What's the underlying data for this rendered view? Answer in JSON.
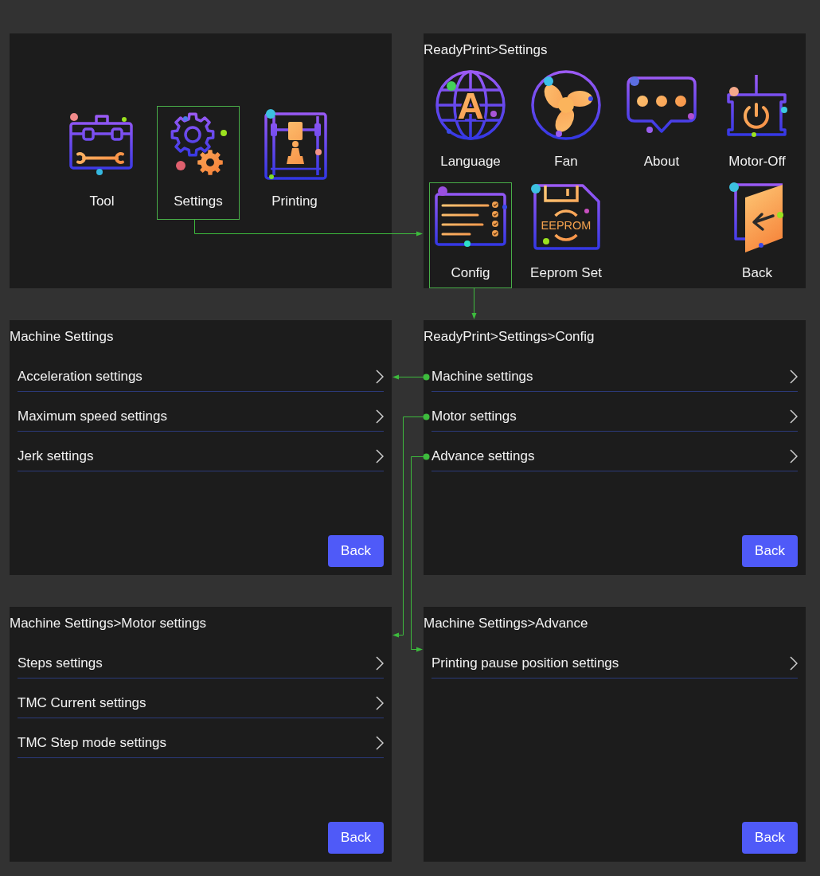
{
  "screens": [
    {
      "kind": "home",
      "tiles": [
        {
          "kind": "toolbox",
          "label": "Tool",
          "selected": false
        },
        {
          "kind": "gears",
          "label": "Settings",
          "selected": true
        },
        {
          "kind": "printer",
          "label": "Printing",
          "selected": false
        }
      ]
    },
    {
      "kind": "grid",
      "title": "ReadyPrint>Settings",
      "tiles": [
        {
          "kind": "globe",
          "label": "Language",
          "selected": false,
          "icon_text": "A"
        },
        {
          "kind": "fan",
          "label": "Fan",
          "selected": false
        },
        {
          "kind": "chat",
          "label": "About",
          "selected": false
        },
        {
          "kind": "power",
          "label": "Motor-Off",
          "selected": false
        },
        {
          "kind": "checklist",
          "label": "Config",
          "selected": true
        },
        {
          "kind": "floppy",
          "label": "Eeprom Set",
          "selected": false,
          "icon_text": "EEPROM"
        }
      ],
      "back_tile": {
        "kind": "door",
        "label": "Back",
        "selected": false
      }
    },
    {
      "kind": "list",
      "title": "Machine Settings",
      "items": [
        "Acceleration settings",
        "Maximum speed settings",
        "Jerk settings"
      ],
      "back_button": "Back"
    },
    {
      "kind": "list",
      "title": "ReadyPrint>Settings>Config",
      "items": [
        "Machine settings",
        "Motor settings",
        "Advance settings"
      ],
      "back_button": "Back"
    },
    {
      "kind": "list",
      "title": "Machine Settings>Motor settings",
      "items": [
        "Steps settings",
        "TMC Current settings",
        "TMC Step mode settings"
      ],
      "back_button": "Back"
    },
    {
      "kind": "list",
      "title": "Machine Settings>Advance",
      "items": [
        "Printing pause position settings"
      ],
      "back_button": "Back"
    }
  ]
}
